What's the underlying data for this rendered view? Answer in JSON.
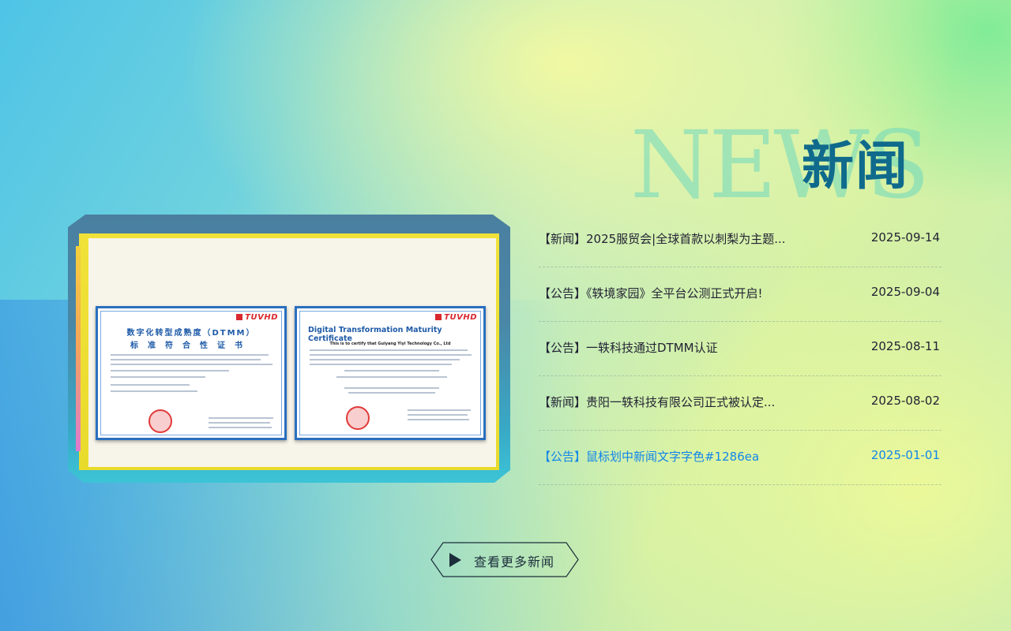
{
  "heading": {
    "bg_text": "NEWS",
    "title": "新闻"
  },
  "certificates": {
    "cn": {
      "brand": "TUVHD",
      "title_line1": "数字化转型成熟度（DTMM）",
      "title_line2": "标准符合性证书"
    },
    "en": {
      "brand": "TUVHD",
      "title": "Digital Transformation Maturity Certificate",
      "subtitle": "This is to certify that Guiyang Yiyi Technology Co., Ltd"
    }
  },
  "news": [
    {
      "title": "【新闻】2025服贸会|全球首款以刺梨为主题...",
      "date": "2025-09-14",
      "hover": false
    },
    {
      "title": "【公告】《轶境家园》全平台公测正式开启!",
      "date": "2025-09-04",
      "hover": false
    },
    {
      "title": "【公告】一轶科技通过DTMM认证",
      "date": "2025-08-11",
      "hover": false
    },
    {
      "title": "【新闻】贵阳一轶科技有限公司正式被认定...",
      "date": "2025-08-02",
      "hover": false
    },
    {
      "title": "【公告】鼠标划中新闻文字字色#1286ea",
      "date": "2025-01-01",
      "hover": true
    }
  ],
  "more_button": {
    "label": "查看更多新闻"
  },
  "colors": {
    "accent": "#1286ea",
    "heading": "#0f6a8c",
    "text": "#222233"
  }
}
